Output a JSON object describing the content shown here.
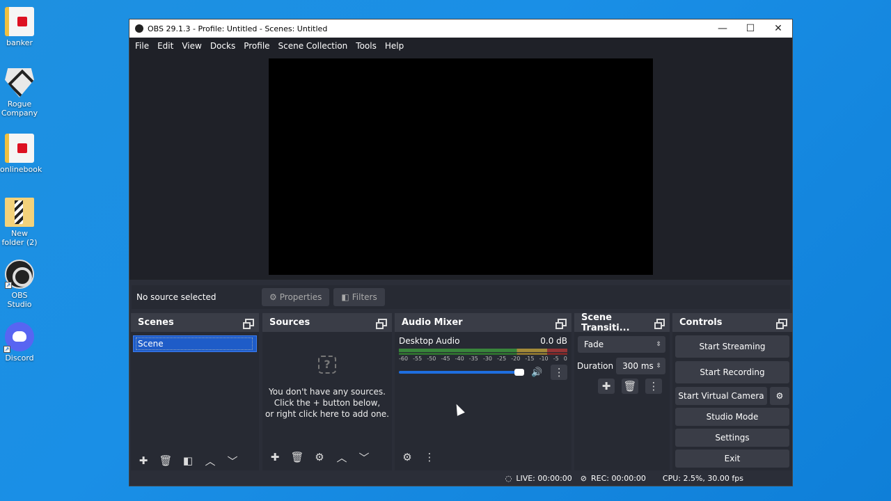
{
  "desktop": {
    "icons": [
      {
        "label": "banker"
      },
      {
        "label": "Rogue Company"
      },
      {
        "label": "onlinebook"
      },
      {
        "label": "New folder (2)"
      },
      {
        "label": "OBS Studio"
      },
      {
        "label": "Discord"
      }
    ]
  },
  "window": {
    "title": "OBS 29.1.3 - Profile: Untitled - Scenes: Untitled",
    "minimize": "—",
    "maximize": "☐",
    "close": "✕"
  },
  "menu": [
    "File",
    "Edit",
    "View",
    "Docks",
    "Profile",
    "Scene Collection",
    "Tools",
    "Help"
  ],
  "source_toolbar": {
    "no_source": "No source selected",
    "properties": "Properties",
    "filters": "Filters"
  },
  "docks": {
    "scenes": {
      "title": "Scenes",
      "items": [
        "Scene"
      ]
    },
    "sources": {
      "title": "Sources",
      "empty_line1": "You don't have any sources.",
      "empty_line2": "Click the + button below,",
      "empty_line3": "or right click here to add one."
    },
    "mixer": {
      "title": "Audio Mixer",
      "channel": "Desktop Audio",
      "level": "0.0 dB",
      "scale": [
        "-60",
        "-55",
        "-50",
        "-45",
        "-40",
        "-35",
        "-30",
        "-25",
        "-20",
        "-15",
        "-10",
        "-5",
        "0"
      ],
      "volume": 1.0
    },
    "transitions": {
      "title": "Scene Transiti...",
      "selected": "Fade",
      "duration_label": "Duration",
      "duration_value": "300 ms"
    },
    "controls": {
      "title": "Controls",
      "start_streaming": "Start Streaming",
      "start_recording": "Start Recording",
      "start_virtual_camera": "Start Virtual Camera",
      "studio_mode": "Studio Mode",
      "settings": "Settings",
      "exit": "Exit"
    }
  },
  "status": {
    "live": "LIVE: 00:00:00",
    "rec": "REC: 00:00:00",
    "cpu": "CPU: 2.5%, 30.00 fps"
  }
}
